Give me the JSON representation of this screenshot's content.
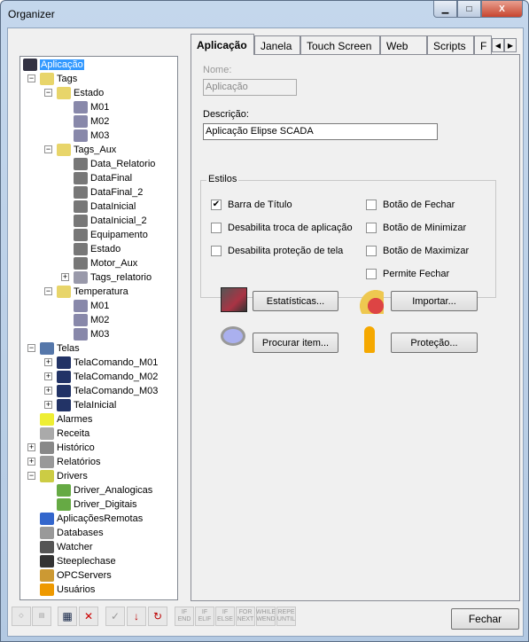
{
  "window": {
    "title": "Organizer",
    "minimize": "▁",
    "maximize": "□",
    "close": "X"
  },
  "tree": [
    {
      "label": "Aplicação",
      "level": 0,
      "exp": "",
      "color": "#334",
      "selected": true
    },
    {
      "label": "Tags",
      "level": 1,
      "exp": "-",
      "color": "#e8d56a"
    },
    {
      "label": "Estado",
      "level": 2,
      "exp": "-",
      "color": "#e8d56a"
    },
    {
      "label": "M01",
      "level": 3,
      "exp": "",
      "color": "#88a"
    },
    {
      "label": "M02",
      "level": 3,
      "exp": "",
      "color": "#88a"
    },
    {
      "label": "M03",
      "level": 3,
      "exp": "",
      "color": "#88a"
    },
    {
      "label": "Tags_Aux",
      "level": 2,
      "exp": "-",
      "color": "#e8d56a"
    },
    {
      "label": "Data_Relatorio",
      "level": 3,
      "exp": "",
      "color": "#777"
    },
    {
      "label": "DataFinal",
      "level": 3,
      "exp": "",
      "color": "#777"
    },
    {
      "label": "DataFinal_2",
      "level": 3,
      "exp": "",
      "color": "#777"
    },
    {
      "label": "DataInicial",
      "level": 3,
      "exp": "",
      "color": "#777"
    },
    {
      "label": "DataInicial_2",
      "level": 3,
      "exp": "",
      "color": "#777"
    },
    {
      "label": "Equipamento",
      "level": 3,
      "exp": "",
      "color": "#777"
    },
    {
      "label": "Estado",
      "level": 3,
      "exp": "",
      "color": "#777"
    },
    {
      "label": "Motor_Aux",
      "level": 3,
      "exp": "",
      "color": "#777"
    },
    {
      "label": "Tags_relatorio",
      "level": 3,
      "exp": "+",
      "color": "#99a"
    },
    {
      "label": "Temperatura",
      "level": 2,
      "exp": "-",
      "color": "#e8d56a"
    },
    {
      "label": "M01",
      "level": 3,
      "exp": "",
      "color": "#88a"
    },
    {
      "label": "M02",
      "level": 3,
      "exp": "",
      "color": "#88a"
    },
    {
      "label": "M03",
      "level": 3,
      "exp": "",
      "color": "#88a"
    },
    {
      "label": "Telas",
      "level": 1,
      "exp": "-",
      "color": "#57a"
    },
    {
      "label": "TelaComando_M01",
      "level": 2,
      "exp": "+",
      "color": "#236"
    },
    {
      "label": "TelaComando_M02",
      "level": 2,
      "exp": "+",
      "color": "#236"
    },
    {
      "label": "TelaComando_M03",
      "level": 2,
      "exp": "+",
      "color": "#236"
    },
    {
      "label": "TelaInicial",
      "level": 2,
      "exp": "+",
      "color": "#236"
    },
    {
      "label": "Alarmes",
      "level": 1,
      "exp": "",
      "color": "#ee3"
    },
    {
      "label": "Receita",
      "level": 1,
      "exp": "",
      "color": "#aaa"
    },
    {
      "label": "Histórico",
      "level": 1,
      "exp": "+",
      "color": "#888"
    },
    {
      "label": "Relatórios",
      "level": 1,
      "exp": "+",
      "color": "#999"
    },
    {
      "label": "Drivers",
      "level": 1,
      "exp": "-",
      "color": "#cc4"
    },
    {
      "label": "Driver_Analogicas",
      "level": 2,
      "exp": "",
      "color": "#6a4"
    },
    {
      "label": "Driver_Digitais",
      "level": 2,
      "exp": "",
      "color": "#6a4"
    },
    {
      "label": "AplicaçõesRemotas",
      "level": 1,
      "exp": "",
      "color": "#36c"
    },
    {
      "label": "Databases",
      "level": 1,
      "exp": "",
      "color": "#999"
    },
    {
      "label": "Watcher",
      "level": 1,
      "exp": "",
      "color": "#555"
    },
    {
      "label": "Steeplechase",
      "level": 1,
      "exp": "",
      "color": "#333"
    },
    {
      "label": "OPCServers",
      "level": 1,
      "exp": "",
      "color": "#c93"
    },
    {
      "label": "Usuários",
      "level": 1,
      "exp": "",
      "color": "#e90"
    }
  ],
  "tabs": [
    "Aplicação",
    "Janela",
    "Touch Screen",
    "Web",
    "Scripts",
    "F"
  ],
  "form": {
    "name_label": "Nome:",
    "name_value": "Aplicação",
    "desc_label": "Descrição:",
    "desc_value": "Aplicação Elipse SCADA",
    "group_label": "Estilos"
  },
  "checks": [
    {
      "label": "Barra de Título",
      "checked": true
    },
    {
      "label": "Desabilita troca de aplicação",
      "checked": false
    },
    {
      "label": "Desabilita proteção de tela",
      "checked": false
    },
    {
      "label": "Botão de Fechar",
      "checked": false
    },
    {
      "label": "Botão de Minimizar",
      "checked": false
    },
    {
      "label": "Botão de Maximizar",
      "checked": false
    },
    {
      "label": "Permite Fechar",
      "checked": false
    }
  ],
  "buttons": {
    "stats": "Estatísticas...",
    "import": "Importar...",
    "search": "Procurar item...",
    "protect": "Proteção...",
    "close": "Fechar"
  },
  "toolbar": [
    "IF END",
    "IF ELIF",
    "IF ELSE",
    "FOR NEXT",
    "WHILE WEND",
    "REPE UNTIL"
  ]
}
